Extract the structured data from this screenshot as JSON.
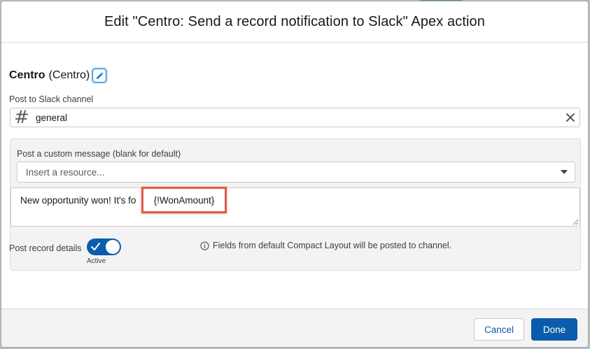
{
  "modal": {
    "title": "Edit \"Centro: Send a record notification to Slack\" Apex action"
  },
  "action": {
    "name": "Centro",
    "api_name": "(Centro)"
  },
  "channel": {
    "label": "Post to Slack channel",
    "prefix": "#",
    "value": "general",
    "icon_prefix": "hash-icon",
    "icon_clear": "close-icon"
  },
  "message": {
    "label": "Post a custom message (blank for default)",
    "resource_placeholder": "Insert a resource...",
    "text_prefix": "New opportunity won! It's fo",
    "merge_field": "{!WonAmount}"
  },
  "record_details": {
    "label": "Post record details",
    "toggle_on": true,
    "toggle_state": "Active",
    "info_text": "Fields from default Compact Layout will be posted to channel."
  },
  "footer": {
    "cancel_label": "Cancel",
    "done_label": "Done"
  },
  "colors": {
    "brand": "#0b5cab",
    "highlight": "#e8564a"
  }
}
